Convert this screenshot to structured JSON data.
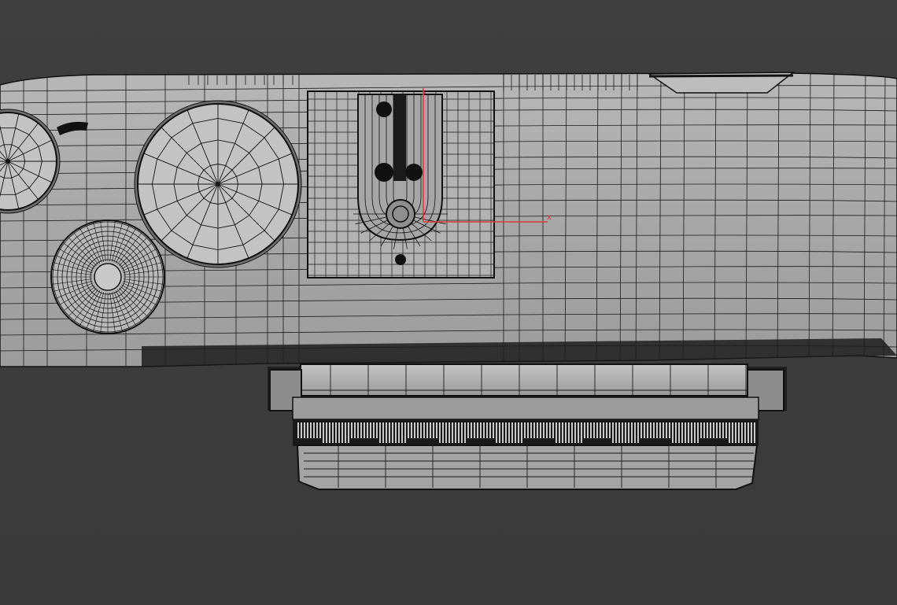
{
  "viewport": {
    "background_color": "#3c3c3c",
    "mesh_fill_color": "#a9a9a9",
    "wire_color": "#111111",
    "display_mode": "wireframe-over-shaded"
  },
  "model": {
    "view": "top",
    "parts": [
      "camera-body-top",
      "mode-dial",
      "shutter-dial",
      "control-dial",
      "hot-shoe",
      "viewfinder-hump",
      "lens-mount",
      "lens-barrel",
      "focus-ring"
    ]
  },
  "gizmo": {
    "x_axis_label": "x",
    "axis_color": "#d83a3a",
    "icon": "transform-gizmo-icon"
  }
}
